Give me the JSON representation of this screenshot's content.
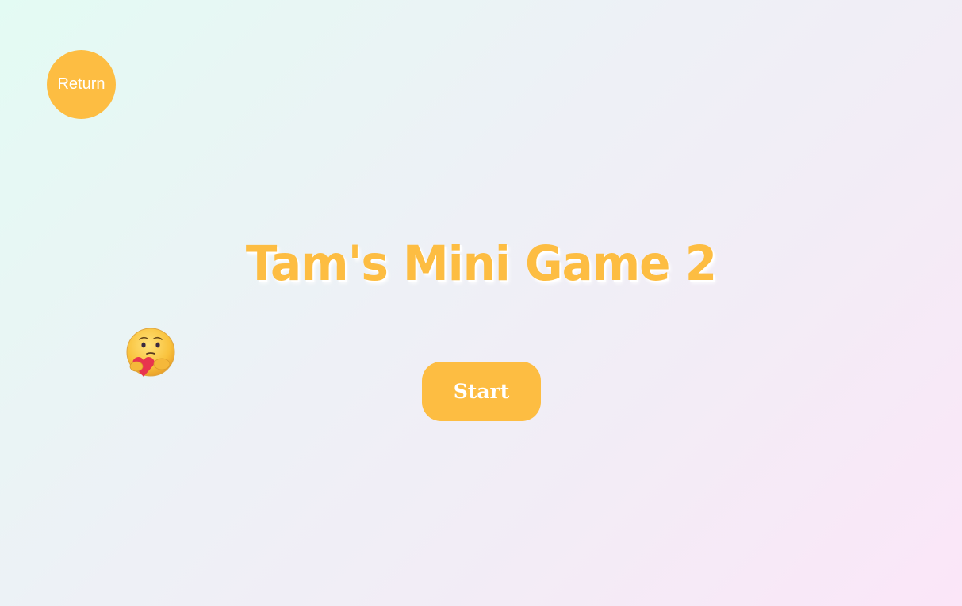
{
  "return_button": {
    "label": "Return"
  },
  "title": "Tam's Mini Game 2",
  "start_button": {
    "label": "Start"
  },
  "character": {
    "icon": "care-hug-emoji-icon"
  },
  "colors": {
    "accent": "#fdbd42",
    "text_on_accent": "#ffffff"
  }
}
